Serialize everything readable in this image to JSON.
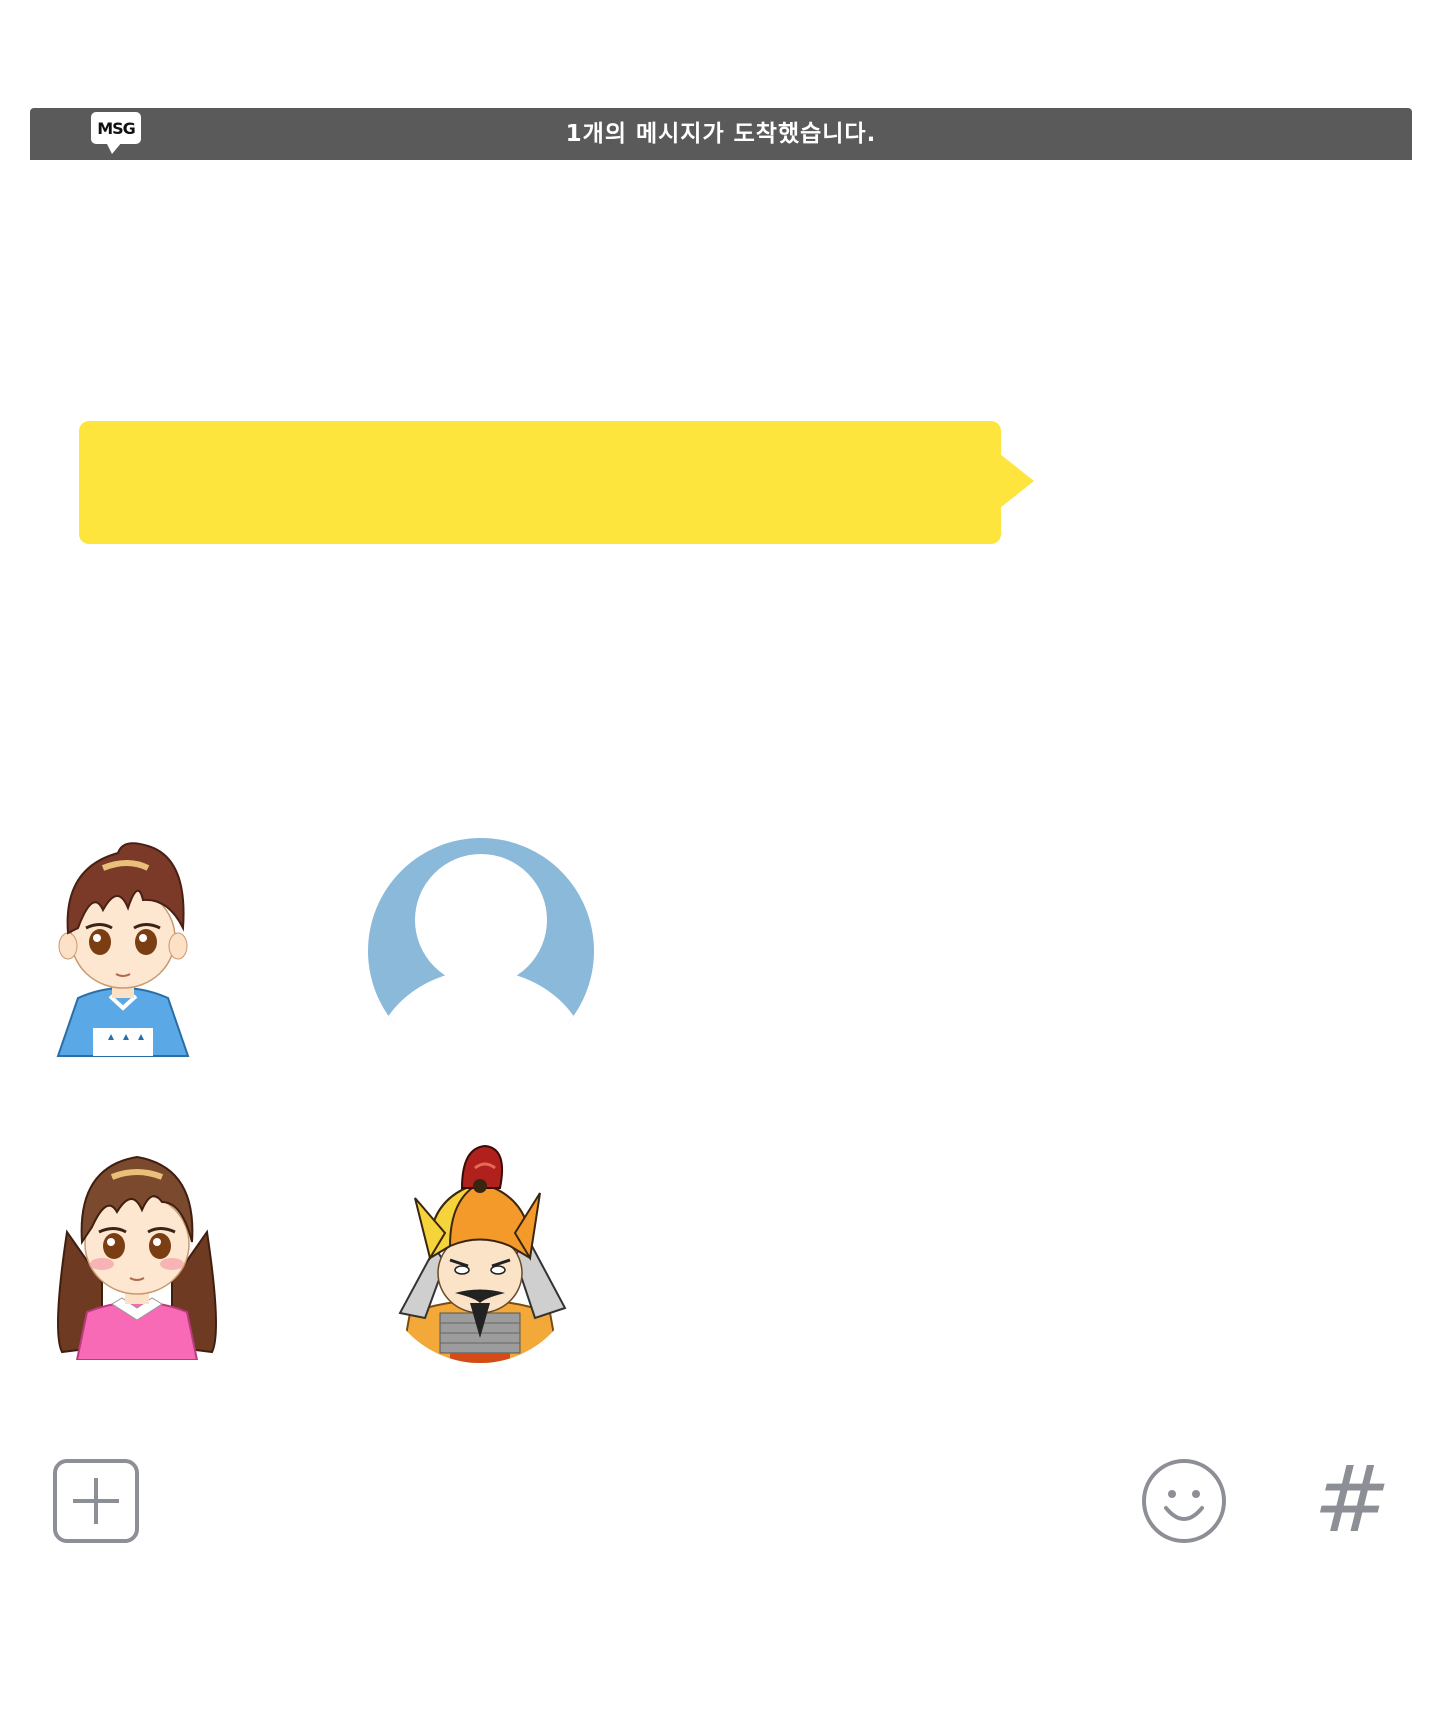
{
  "notification": {
    "badge_label": "MSG",
    "message": "1개의 메시지가 도착했습니다."
  },
  "chat": {
    "bubble_text": "",
    "bubble_color": "#fde53d"
  },
  "avatars": [
    {
      "name": "boy-avatar",
      "icon": "boy-character"
    },
    {
      "name": "default-profile-avatar",
      "icon": "person-silhouette"
    },
    {
      "name": "girl-avatar",
      "icon": "girl-character"
    },
    {
      "name": "general-avatar",
      "icon": "warrior-character"
    }
  ],
  "toolbar": {
    "add_icon": "plus-square-icon",
    "emoji_icon": "smiley-icon",
    "hashtag_label": "#"
  },
  "colors": {
    "notification_bar": "#5a5a5a",
    "default_avatar": "#8ab9da",
    "toolbar_icon": "#8c8f96"
  }
}
